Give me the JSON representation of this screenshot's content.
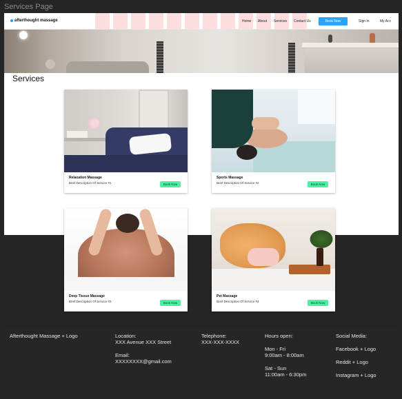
{
  "frame_title": "Services Page",
  "nav": {
    "logo": "afterthought massage",
    "links": [
      "Home",
      "About",
      "Services",
      "Contact Us"
    ],
    "book_now": "Book Now",
    "sign_in": "Sign In",
    "my_account": "My Acc"
  },
  "section_title": "Services",
  "cards": [
    {
      "name": "Relaxation Massage",
      "desc": "Brief Description Of Service #1",
      "button": "Book Now"
    },
    {
      "name": "Sports Massage",
      "desc": "Brief Description Of Service #2",
      "button": "Book Now"
    },
    {
      "name": "Deep Tissue Massage",
      "desc": "Brief Description Of Service #3",
      "button": "Book Now"
    },
    {
      "name": "Pet Massage",
      "desc": "Brief Description Of Service #4",
      "button": "Book Now"
    }
  ],
  "footer": {
    "brand": "Afterthought Massage + Logo",
    "location_label": "Location:",
    "location_value": "XXX Avenue XXX Street",
    "email_label": "Email:",
    "email_value": "XXXXXXXX@gmail.com",
    "telephone_label": "Telephone:",
    "telephone_value": "XXX-XXX-XXXX",
    "hours_label": "Hours open:",
    "hours_weekday_days": "Mon - Fri",
    "hours_weekday_time": "9:00am - 8:00am",
    "hours_weekend_days": "Sat - Sun",
    "hours_weekend_time": "11:00am - 6:30pm",
    "social_label": "Social Media:",
    "social": [
      "Facebook + Logo",
      "Reddit + Logo",
      "Instagram + Logo"
    ]
  },
  "colors": {
    "book_button": "#2da3f5",
    "card_button": "#4cf0a2",
    "nav_placeholders": "#fddede",
    "background": "#252525"
  }
}
